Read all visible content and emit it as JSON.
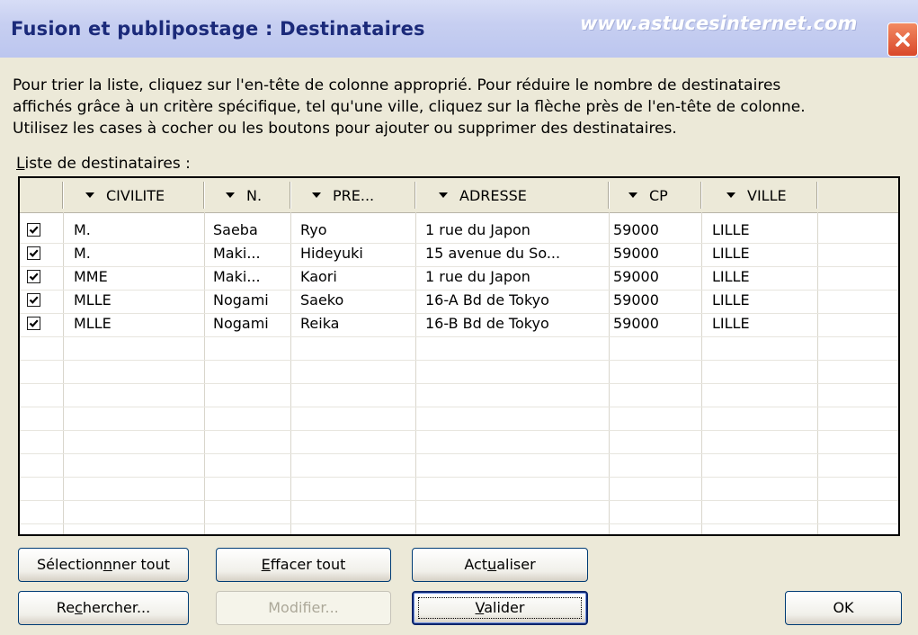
{
  "window": {
    "title": "Fusion et publipostage : Destinataires",
    "watermark": "www.astucesinternet.com",
    "close_icon": "close-icon"
  },
  "instructions": [
    "Pour trier la liste, cliquez sur l'en-tête de colonne approprié. Pour réduire le nombre de destinataires",
    "affichés grâce à un critère spécifique, tel qu'une ville, cliquez sur la flèche près de l'en-tête de colonne.",
    "Utilisez les cases à cocher ou les boutons pour ajouter ou supprimer des destinataires."
  ],
  "list_label": "Liste de destinataires :",
  "columns": [
    {
      "key": "civilite",
      "label": "CIVILITE"
    },
    {
      "key": "nom",
      "label": "N."
    },
    {
      "key": "prenom",
      "label": "PRE..."
    },
    {
      "key": "adresse",
      "label": "ADRESSE"
    },
    {
      "key": "cp",
      "label": "CP"
    },
    {
      "key": "ville",
      "label": "VILLE"
    }
  ],
  "rows": [
    {
      "checked": true,
      "civilite": "M.",
      "nom": "Saeba",
      "prenom": "Ryo",
      "adresse": "1 rue du Japon",
      "cp": "59000",
      "ville": "LILLE"
    },
    {
      "checked": true,
      "civilite": "M.",
      "nom": "Maki...",
      "prenom": "Hideyuki",
      "adresse": "15 avenue du So...",
      "cp": "59000",
      "ville": "LILLE"
    },
    {
      "checked": true,
      "civilite": "MME",
      "nom": "Maki...",
      "prenom": "Kaori",
      "adresse": "1 rue du Japon",
      "cp": "59000",
      "ville": "LILLE"
    },
    {
      "checked": true,
      "civilite": "MLLE",
      "nom": "Nogami",
      "prenom": "Saeko",
      "adresse": "16-A Bd de Tokyo",
      "cp": "59000",
      "ville": "LILLE"
    },
    {
      "checked": true,
      "civilite": "MLLE",
      "nom": "Nogami",
      "prenom": "Reika",
      "adresse": "16-B Bd de Tokyo",
      "cp": "59000",
      "ville": "LILLE"
    }
  ],
  "buttons": {
    "select_all": {
      "before": "Sélection",
      "key": "n",
      "after": "ner tout"
    },
    "clear_all": {
      "before": "",
      "key": "E",
      "after": "ffacer tout"
    },
    "refresh": {
      "before": "Act",
      "key": "u",
      "after": "aliser"
    },
    "search": {
      "before": "Re",
      "key": "c",
      "after": "hercher..."
    },
    "edit": {
      "label": "Modifier..."
    },
    "validate": {
      "before": "",
      "key": "V",
      "after": "alider"
    },
    "ok": {
      "label": "OK"
    }
  },
  "colors": {
    "title_text": "#1b2a7a",
    "dialog_bg": "#ece9d8",
    "button_border": "#003c74",
    "close_red": "#d9482a"
  }
}
